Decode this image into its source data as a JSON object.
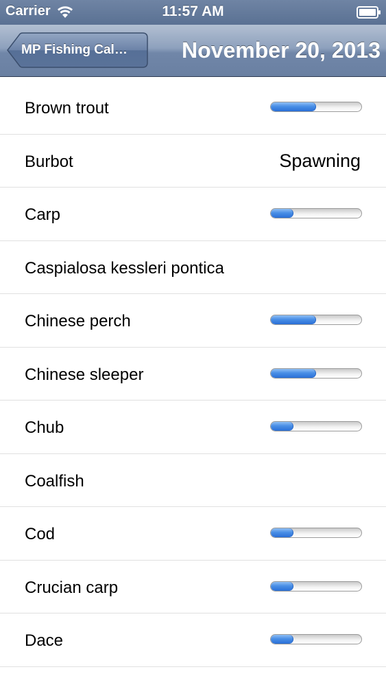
{
  "status_bar": {
    "carrier": "Carrier",
    "time": "11:57 AM",
    "wifi_icon": "wifi-icon",
    "battery_icon": "battery-icon"
  },
  "nav": {
    "back_label": "MP Fishing Cal…",
    "title": "November 20, 2013"
  },
  "colors": {
    "nav_bar": "#7086a8",
    "progress_fill": "#3a7fe0",
    "separator": "#e0e0e0"
  },
  "fish": [
    {
      "name": "Brown trout",
      "activity": 0.5,
      "status": ""
    },
    {
      "name": "Burbot",
      "activity": null,
      "status": "Spawning"
    },
    {
      "name": "Carp",
      "activity": 0.25,
      "status": ""
    },
    {
      "name": "Caspialosa kessleri pontica",
      "activity": null,
      "status": ""
    },
    {
      "name": "Chinese perch",
      "activity": 0.5,
      "status": ""
    },
    {
      "name": "Chinese sleeper",
      "activity": 0.5,
      "status": ""
    },
    {
      "name": "Chub",
      "activity": 0.25,
      "status": ""
    },
    {
      "name": "Coalfish",
      "activity": null,
      "status": ""
    },
    {
      "name": "Cod",
      "activity": 0.25,
      "status": ""
    },
    {
      "name": "Crucian carp",
      "activity": 0.25,
      "status": ""
    },
    {
      "name": "Dace",
      "activity": 0.25,
      "status": ""
    }
  ]
}
